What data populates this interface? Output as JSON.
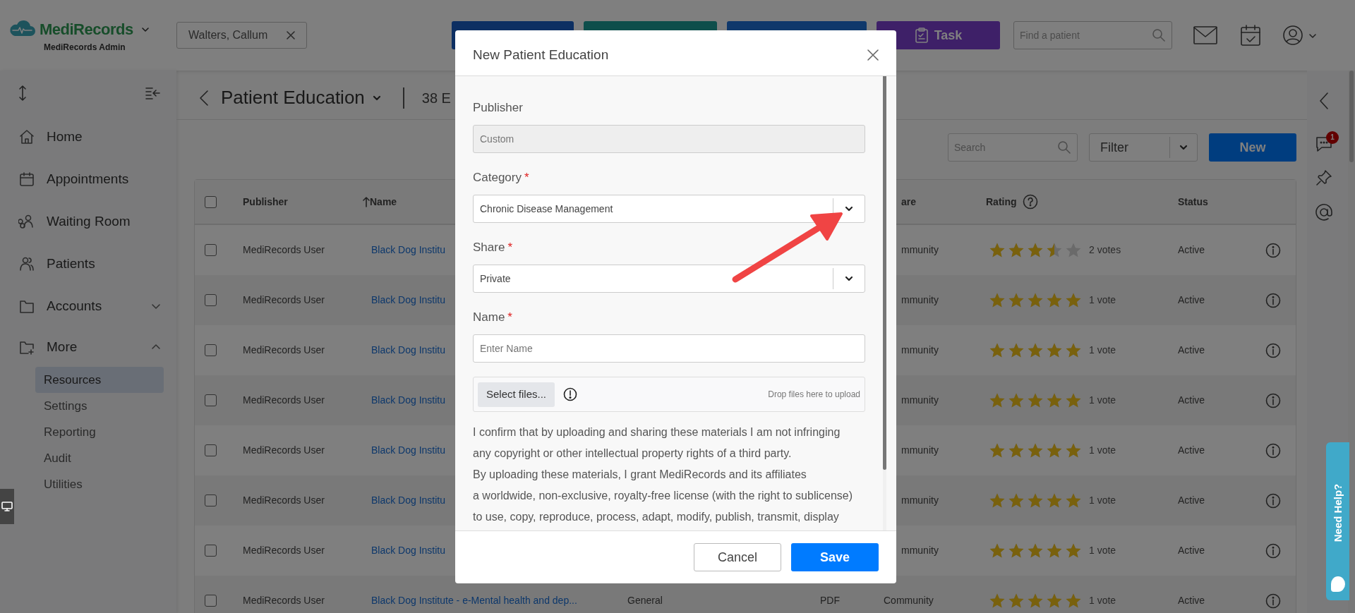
{
  "app": {
    "logo": "MediRecords",
    "subtitle": "MediRecords Admin"
  },
  "patient_tab": {
    "label": "Walters, Callum"
  },
  "header_actions": [
    {
      "color": "#0d2f62"
    },
    {
      "color": "#0e4e4b"
    },
    {
      "color": "#0f386b"
    },
    {
      "label": "Task",
      "color": "#3e2068"
    }
  ],
  "patient_search": {
    "placeholder": "Find a patient"
  },
  "sidebar": {
    "items": [
      {
        "label": "Home"
      },
      {
        "label": "Appointments"
      },
      {
        "label": "Waiting Room"
      },
      {
        "label": "Patients"
      },
      {
        "label": "Accounts",
        "expanded": false
      },
      {
        "label": "More",
        "expanded": true,
        "children": [
          {
            "label": "Resources",
            "selected": true
          },
          {
            "label": "Settings",
            "selected": false
          },
          {
            "label": "Reporting",
            "selected": false
          },
          {
            "label": "Audit",
            "selected": false
          },
          {
            "label": "Utilities",
            "selected": false
          }
        ]
      }
    ]
  },
  "page": {
    "title": "Patient Education",
    "count": "38 E"
  },
  "toolbar": {
    "search_placeholder": "Search",
    "filter": "Filter",
    "new": "New"
  },
  "table": {
    "all_checked": false,
    "columns": {
      "publisher": "Publisher",
      "name": "Name",
      "name_sort_ascending": true,
      "share": "are",
      "rating": "Rating",
      "status": "Status"
    },
    "rows": [
      {
        "checked": false,
        "publisher": "MediRecords User",
        "name": "Black Dog Institu",
        "share": "mmunity",
        "stars": 3.5,
        "votes": "2 votes",
        "status": "Active"
      },
      {
        "checked": false,
        "publisher": "MediRecords User",
        "name": "Black Dog Institu",
        "share": "mmunity",
        "stars": 5,
        "votes": "1 vote",
        "status": "Active"
      },
      {
        "checked": false,
        "publisher": "MediRecords User",
        "name": "Black Dog Institu",
        "share": "mmunity",
        "stars": 5,
        "votes": "1 vote",
        "status": "Active"
      },
      {
        "checked": false,
        "publisher": "MediRecords User",
        "name": "Black Dog Institu",
        "share": "mmunity",
        "stars": 5,
        "votes": "1 vote",
        "status": "Active"
      },
      {
        "checked": false,
        "publisher": "MediRecords User",
        "name": "Black Dog Institu",
        "share": "mmunity",
        "stars": 5,
        "votes": "1 vote",
        "status": "Active"
      },
      {
        "checked": false,
        "publisher": "MediRecords User",
        "name": "Black Dog Institu",
        "share": "mmunity",
        "stars": 5,
        "votes": "1 vote",
        "status": "Active"
      },
      {
        "checked": false,
        "publisher": "MediRecords User",
        "name": "Black Dog Institu",
        "share": "mmunity",
        "stars": 5,
        "votes": "1 vote",
        "status": "Active"
      },
      {
        "checked": false,
        "publisher": "MediRecords User",
        "name": "Black Dog Institute - e-Mental health and dep...",
        "category": "General",
        "type": "PDF",
        "share": "Community",
        "stars": 5,
        "votes": "1 vote",
        "status": "Active"
      }
    ]
  },
  "right_rail": {
    "notification_badge": "1"
  },
  "help_tab": {
    "label": "Need Help?"
  },
  "modal": {
    "title": "New Patient Education",
    "fields": [
      {
        "kind": "readonly",
        "label": "Publisher",
        "value": "Custom"
      },
      {
        "kind": "select",
        "label": "Category",
        "required_mark": "*",
        "value": "Chronic Disease Management"
      },
      {
        "kind": "select",
        "label": "Share",
        "required_mark": "*",
        "value": "Private"
      },
      {
        "kind": "text",
        "label": "Name",
        "required_mark": "*",
        "placeholder": "Enter Name"
      }
    ],
    "upload": {
      "button": "Select files...",
      "hint": "Drop files here to upload"
    },
    "legal_lines": [
      "I confirm that by uploading and sharing these materials I am not infringing",
      "any copyright or other intellectual property rights of a third party.",
      "By uploading these materials, I grant MediRecords and its affiliates",
      "a worldwide, non-exclusive, royalty-free license (with the right to sublicense)",
      "to use, copy, reproduce, process, adapt, modify, publish, transmit, display"
    ],
    "buttons": [
      {
        "kind": "secondary",
        "label": "Cancel"
      },
      {
        "kind": "primary",
        "label": "Save"
      }
    ]
  }
}
